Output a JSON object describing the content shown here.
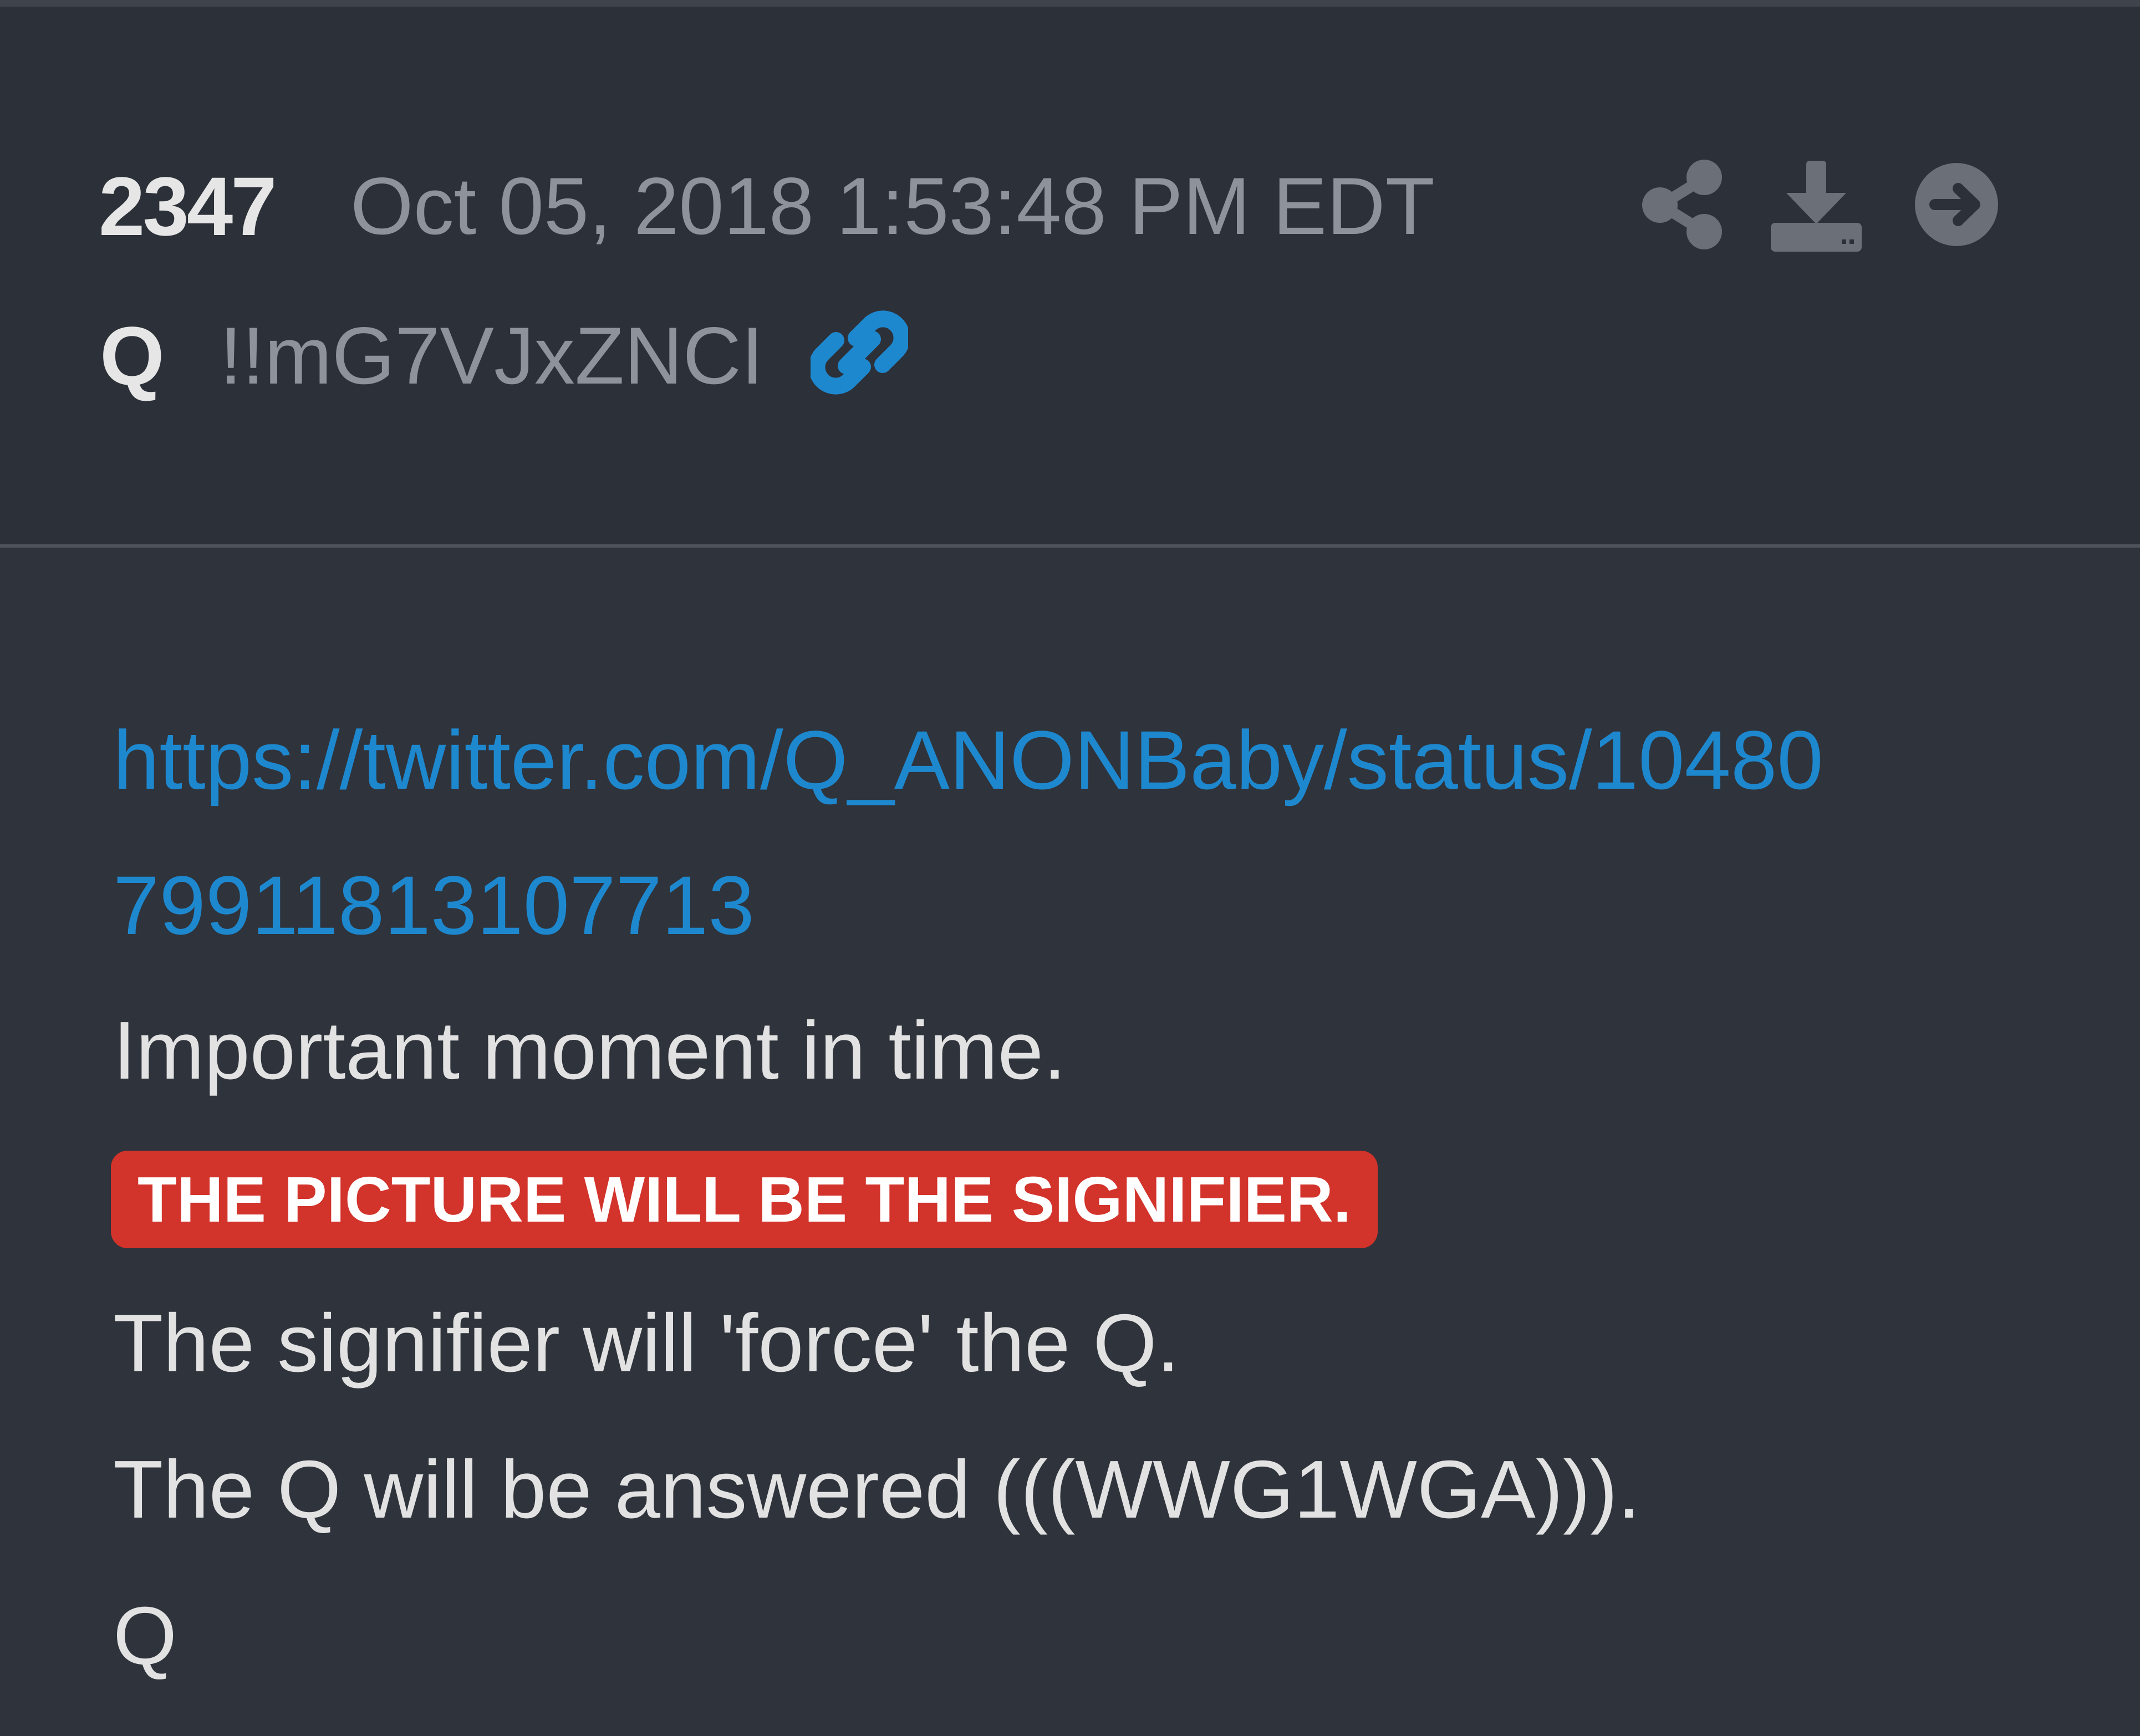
{
  "post": {
    "number": "2347",
    "date": "Oct 05, 2018 1:53:48 PM EDT",
    "author": "Q",
    "tripcode": "!!mG7VJxZNCI"
  },
  "icons": {
    "share": "share-icon",
    "download": "download-icon",
    "navigate": "arrow-right-circle-icon",
    "link": "link-icon"
  },
  "body": {
    "url_part1": "https://twitter.com/Q_ANONBaby/status/10480",
    "url_part2": "79911813107713",
    "line1": "Important moment in time.",
    "highlight": "THE PICTURE WILL BE THE SIGNIFIER.",
    "line2": "The signifier will 'force' the Q.",
    "line3": "The Q will be answered (((WWG1WGA))).",
    "signature": "Q"
  },
  "colors": {
    "background": "#2f333b",
    "header": "#2c3038",
    "link": "#1e88cf",
    "highlight": "#d2332b",
    "muted": "#8d929b",
    "text": "#e2e2e2"
  }
}
